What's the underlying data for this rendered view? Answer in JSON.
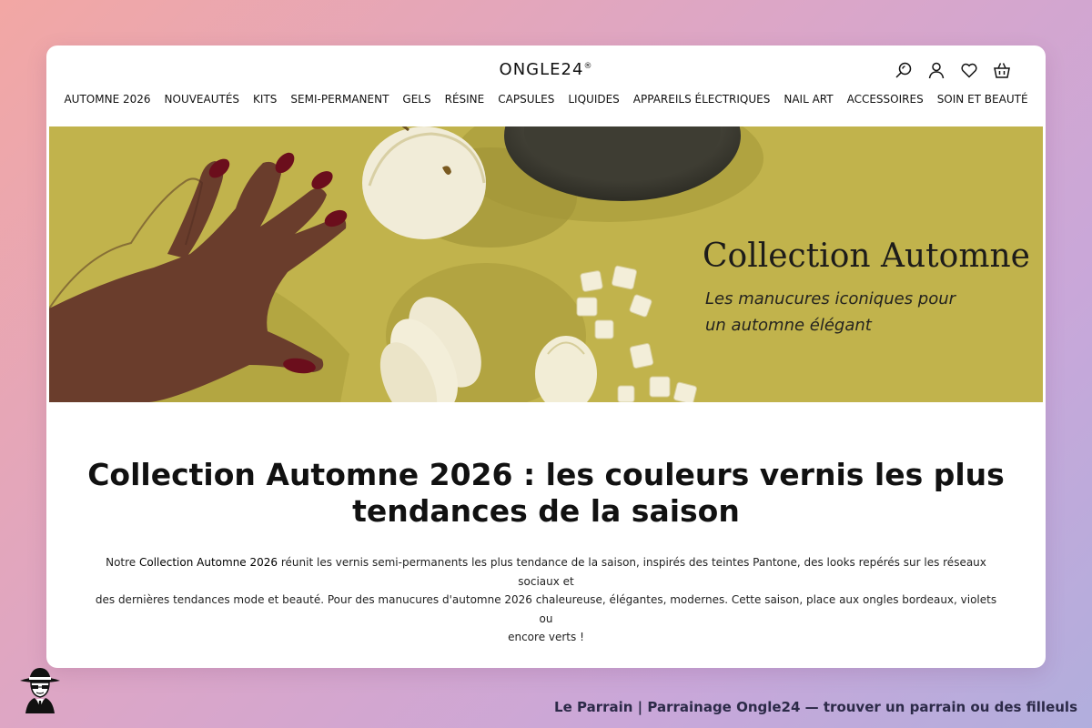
{
  "header": {
    "logo": "ONGLE24",
    "logo_mark": "®",
    "icons": [
      "search-icon",
      "user-icon",
      "heart-icon",
      "basket-icon"
    ]
  },
  "nav": {
    "items": [
      "AUTOMNE 2026",
      "NOUVEAUTÉS",
      "KITS",
      "SEMI-PERMANENT",
      "GELS",
      "RÉSINE",
      "CAPSULES",
      "LIQUIDES",
      "APPAREILS ÉLECTRIQUES",
      "NAIL ART",
      "ACCESSOIRES",
      "SOIN ET BEAUTÉ"
    ]
  },
  "hero": {
    "title": "Collection Automne",
    "subtitle_line1": "Les manucures iconiques pour",
    "subtitle_line2": "un automne élégant",
    "background_color": "#c1b34c",
    "nail_color": "#6b0e1c"
  },
  "main": {
    "title_line1": "Collection Automne 2026 : les couleurs vernis les plus",
    "title_line2": "tendances de la saison",
    "desc_prefix": "Notre ",
    "desc_highlight": "Collection Automne 2026",
    "desc_line1_rest": " réunit les vernis semi-permanents les plus tendance de la saison, inspirés des teintes Pantone, des looks repérés sur les réseaux sociaux et",
    "desc_line2": "des dernières tendances mode et beauté. Pour des manucures d'automne 2026 chaleureuse, élégantes, modernes. Cette saison, place aux ongles bordeaux, violets ou",
    "desc_line3": "encore verts !"
  },
  "footer": {
    "text": "Le Parrain | Parrainage Ongle24 — trouver un parrain ou des filleuls",
    "logo_icon": "mafia-man-icon"
  }
}
